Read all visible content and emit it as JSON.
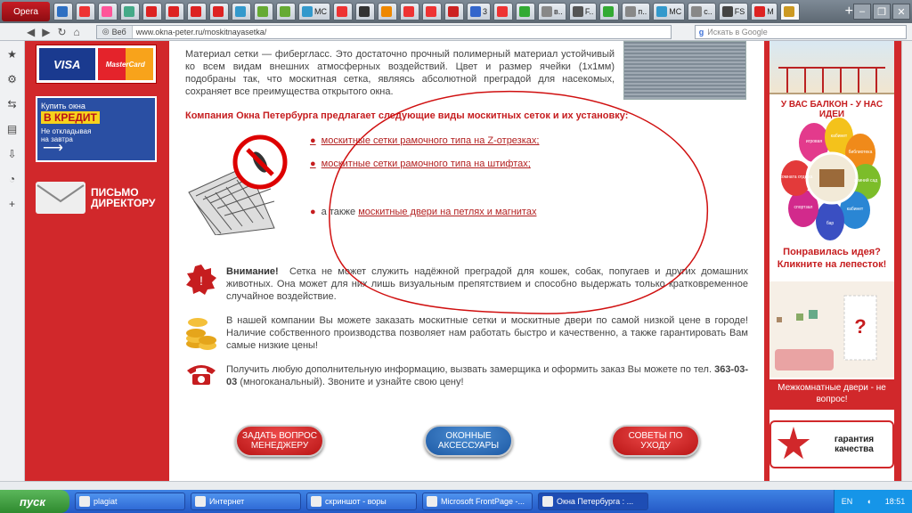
{
  "browser": {
    "menu_label": "Opera",
    "tabs": [
      {
        "label": "",
        "color": "#2d6fc2"
      },
      {
        "label": "",
        "color": "#e33"
      },
      {
        "label": "",
        "color": "#f59"
      },
      {
        "label": "",
        "color": "#4a8"
      },
      {
        "label": "",
        "color": "#d22"
      },
      {
        "label": "",
        "color": "#d22"
      },
      {
        "label": "",
        "color": "#d22"
      },
      {
        "label": "",
        "color": "#d22"
      },
      {
        "label": "",
        "color": "#39c"
      },
      {
        "label": "",
        "color": "#6a3"
      },
      {
        "label": "",
        "color": "#6a3"
      },
      {
        "label": "MC",
        "color": "#39c"
      },
      {
        "label": "",
        "color": "#e33"
      },
      {
        "label": "",
        "color": "#333"
      },
      {
        "label": "",
        "color": "#e80"
      },
      {
        "label": "",
        "color": "#e33"
      },
      {
        "label": "",
        "color": "#e33"
      },
      {
        "label": "",
        "color": "#c22"
      },
      {
        "label": "3",
        "color": "#36c"
      },
      {
        "label": "",
        "color": "#e33"
      },
      {
        "label": "",
        "color": "#3a3"
      },
      {
        "label": "в..",
        "color": "#888"
      },
      {
        "label": "F..",
        "color": "#555"
      },
      {
        "label": "",
        "color": "#3a3"
      },
      {
        "label": "п..",
        "color": "#888"
      },
      {
        "label": "MC",
        "color": "#39c"
      },
      {
        "label": "с..",
        "color": "#888"
      },
      {
        "label": "FS",
        "color": "#444"
      },
      {
        "label": "M",
        "color": "#d22"
      },
      {
        "label": "",
        "color": "#c92"
      }
    ],
    "new_tab": "+",
    "url_label": "Веб",
    "url": "www.okna-peter.ru/moskitnayasetka/",
    "search_placeholder": "Искать в Google"
  },
  "page": {
    "intro": "Материал сетки — фибергласс. Это достаточно прочный полимерный материал устойчивый ко всем видам внешних атмосферных воздействий. Цвет и размер ячейки (1х1мм) подобраны так, что москитная сетка, являясь абсолютной преградой для насекомых, сохраняет все преимущества открытого окна.",
    "heading": "Компания Окна Петербурга предлагает следующие виды москитных сеток и их установку:",
    "links": [
      "москитные сетки рамочного типа на Z-отрезках;",
      "москитные сетки рамочного типа на штифтах;"
    ],
    "also_prefix": "а также",
    "also_link": "москитные двери на петлях и магнитах",
    "warning_bold": "Внимание!",
    "warning": "Сетка не может служить надёжной преградой для кошек, собак, попугаев и других домашних животных. Она может для них лишь визуальным препятствием и способно выдержать только кратковременное случайное воздействие.",
    "prices": "В нашей компании Вы можете заказать москитные сетки и москитные двери по самой низкой цене в городе! Наличие собственного производства позволяет нам работать быстро и качественно, а также гарантировать Вам самые низкие цены!",
    "contact_prefix": "Получить любую дополнительную информацию, вызвать замерщика и оформить заказ Вы можете по тел.",
    "phone": "363-03-03",
    "contact_suffix": "(многоканальный). Звоните и узнайте свою цену!",
    "buttons": {
      "question": "ЗАДАТЬ ВОПРОС МЕНЕДЖЕРУ",
      "accessories": "ОКОННЫЕ АКСЕССУАРЫ",
      "tips": "СОВЕТЫ ПО УХОДУ"
    }
  },
  "left": {
    "visa": "VISA",
    "mastercard": "MasterCard",
    "credit_line1": "Купить окна",
    "credit_line2": "В КРЕДИТ",
    "credit_line3": "Не откладывая на завтра",
    "letter": "ПИСЬМО ДИРЕКТОРУ"
  },
  "right": {
    "balcony_title": "У ВАС БАЛКОН - У НАС ИДЕИ",
    "petals": [
      "игровая",
      "кабинет",
      "библиотека",
      "зимний сад",
      "кабинет",
      "бар",
      "спортзал",
      "комната отдыха"
    ],
    "idea": "Понравилась идея? Кликните на лепесток!",
    "doors": "Межкомнатные двери - не вопрос!",
    "guarantee": "гарантия качества"
  },
  "taskbar": {
    "start": "пуск",
    "tasks": [
      "plagiat",
      "Интернет",
      "скриншот - воры",
      "Microsoft FrontPage -...",
      "Окна Петербурга : ..."
    ],
    "lang": "EN",
    "clock": "18:51"
  }
}
